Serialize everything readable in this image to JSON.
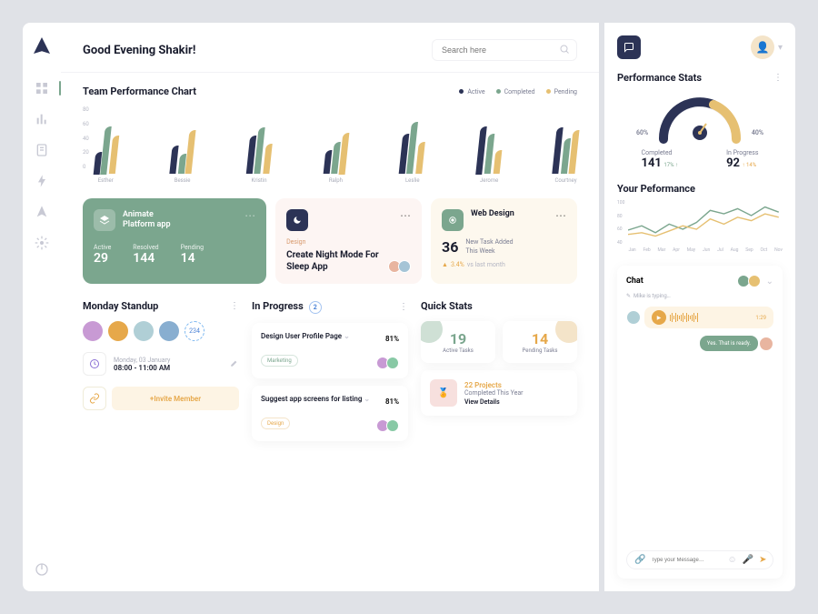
{
  "greeting": "Good Evening Shakir!",
  "search": {
    "placeholder": "Search here"
  },
  "sidebar": {
    "items": [
      "dashboard",
      "analytics",
      "docs",
      "activity",
      "notify",
      "settings"
    ],
    "active": 0
  },
  "chart": {
    "title": "Team Performance Chart",
    "legend": [
      "Active",
      "Completed",
      "Pending"
    ],
    "yticks": [
      "80",
      "60",
      "40",
      "20",
      "0"
    ]
  },
  "chart_data": {
    "type": "bar",
    "categories": [
      "Esther",
      "Bessie",
      "Kristin",
      "Ralph",
      "Leslie",
      "Jerome",
      "Courtney"
    ],
    "series": [
      {
        "name": "Active",
        "color": "#2c3356",
        "values": [
          28,
          35,
          48,
          30,
          50,
          60,
          58
        ]
      },
      {
        "name": "Completed",
        "color": "#7ba68e",
        "values": [
          60,
          25,
          58,
          40,
          65,
          50,
          45
        ]
      },
      {
        "name": "Pending",
        "color": "#e6c072",
        "values": [
          48,
          55,
          38,
          52,
          40,
          30,
          55
        ]
      }
    ],
    "ylim": [
      0,
      80
    ]
  },
  "cards": {
    "animate": {
      "title1": "Animate",
      "title2": "Platform app",
      "stats": [
        {
          "label": "Active",
          "value": "29"
        },
        {
          "label": "Resolved",
          "value": "144"
        },
        {
          "label": "Pending",
          "value": "14"
        }
      ]
    },
    "design": {
      "label": "Design",
      "title": "Create Night Mode For Sleep App"
    },
    "web": {
      "title": "Web Design",
      "big": "36",
      "sub1": "New Task Added",
      "sub2": "This Week",
      "delta": "3.4%",
      "deltaLabel": "vs last month"
    }
  },
  "standup": {
    "title": "Monday Standup",
    "extra": "234",
    "dateLabel": "Monday, 03 January",
    "time": "08:00 - 11:00 AM",
    "invite": "Invite Member"
  },
  "progress": {
    "title": "In Progress",
    "count": "2",
    "tasks": [
      {
        "title": "Design User Profile Page",
        "tag": "Marketing",
        "tagClass": "tag-mkt",
        "pct": "81%"
      },
      {
        "title": "Suggest app screens for listing",
        "tag": "Design",
        "tagClass": "tag-dsn",
        "pct": "81%"
      }
    ]
  },
  "quick": {
    "title": "Quick Stats",
    "active": {
      "num": "19",
      "label": "Active Tasks"
    },
    "pending": {
      "num": "14",
      "label": "Pending Tasks"
    },
    "projects": {
      "num": "22 Projects",
      "sub": "Completed This Year",
      "view": "View Details"
    }
  },
  "right": {
    "perfTitle": "Performance Stats",
    "gauge": {
      "left": "60%",
      "right": "40%"
    },
    "completed": {
      "label": "Completed",
      "val": "141",
      "chg": "17% ↑"
    },
    "inprogress": {
      "label": "In Progress",
      "val": "92",
      "chg": "↑ 14%"
    },
    "yourPerf": "Your Peformance",
    "line_yticks": [
      "100",
      "80",
      "60",
      "40"
    ],
    "line_xticks": [
      "Jan",
      "Feb",
      "Mar",
      "Apr",
      "May",
      "Jun",
      "Jul",
      "Aug",
      "Sep",
      "Oct",
      "Nov"
    ]
  },
  "chat": {
    "title": "Chat",
    "typing": "Mike is typing…",
    "voiceTime": "1:29",
    "msg": "Yes. That is ready.",
    "placeholder": "Type your Message…"
  },
  "colors": {
    "navy": "#2c3356",
    "green": "#7ba68e",
    "gold": "#e6c072"
  }
}
